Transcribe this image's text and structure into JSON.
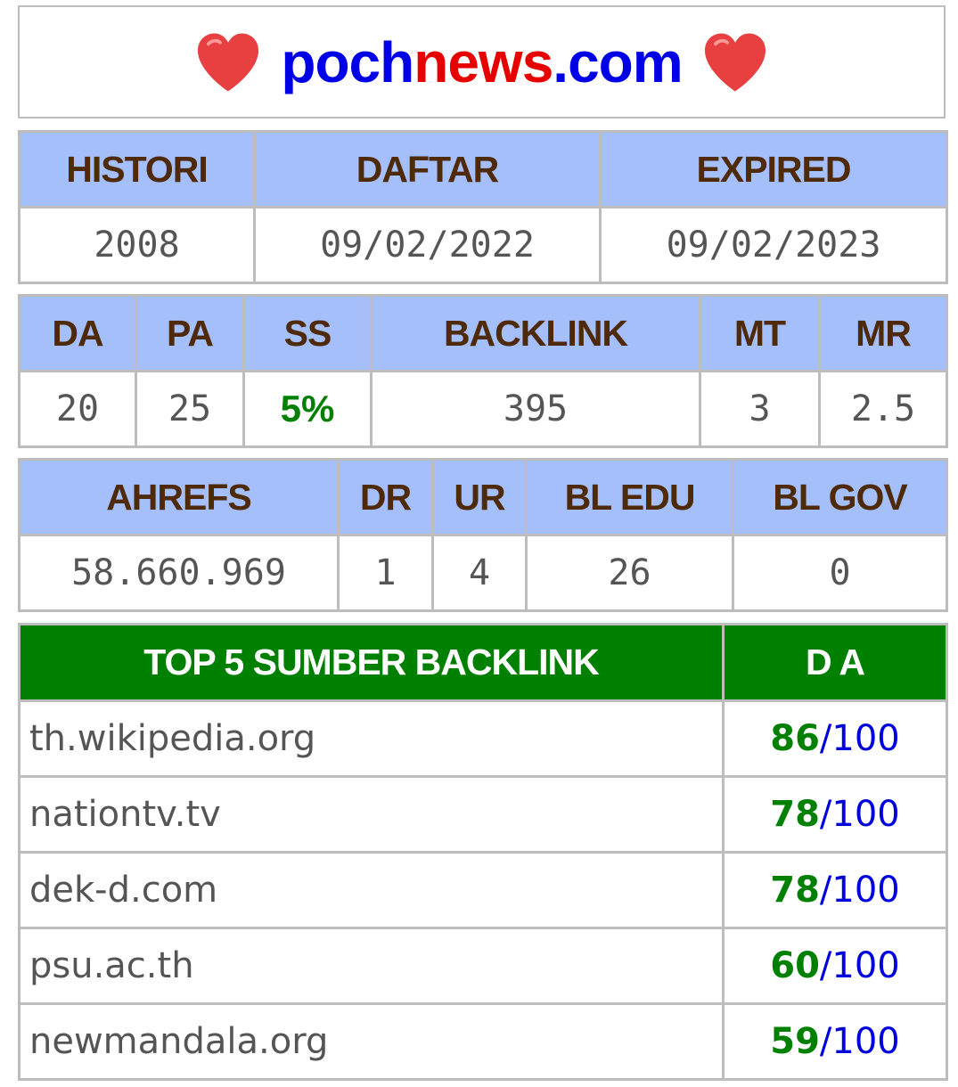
{
  "header": {
    "domain_prefix": "poch",
    "domain_mid": "news",
    "domain_suffix": ".com",
    "colors": {
      "blue": "#0000e6",
      "red": "#e60000",
      "heart": "#e84040"
    },
    "heart_icon": "heart-icon"
  },
  "registration": {
    "headers": [
      "HISTORI",
      "DAFTAR",
      "EXPIRED"
    ],
    "values": [
      "2008",
      "09/02/2022",
      "09/02/2023"
    ]
  },
  "metrics": {
    "headers": [
      "DA",
      "PA",
      "SS",
      "BACKLINK",
      "MT",
      "MR"
    ],
    "values": [
      "20",
      "25",
      "5%",
      "395",
      "3",
      "2.5"
    ]
  },
  "ahrefs": {
    "headers": [
      "AHREFS",
      "DR",
      "UR",
      "BL EDU",
      "BL GOV"
    ],
    "values": [
      "58.660.969",
      "1",
      "4",
      "26",
      "0"
    ]
  },
  "top_sources": {
    "title": "TOP 5 SUMBER BACKLINK",
    "da_header": "D A",
    "separator": "/",
    "rows": [
      {
        "site": "th.wikipedia.org",
        "score": "86",
        "max": "100"
      },
      {
        "site": "nationtv.tv",
        "score": "78",
        "max": "100"
      },
      {
        "site": "dek-d.com",
        "score": "78",
        "max": "100"
      },
      {
        "site": "psu.ac.th",
        "score": "60",
        "max": "100"
      },
      {
        "site": "newmandala.org",
        "score": "59",
        "max": "100"
      }
    ]
  }
}
